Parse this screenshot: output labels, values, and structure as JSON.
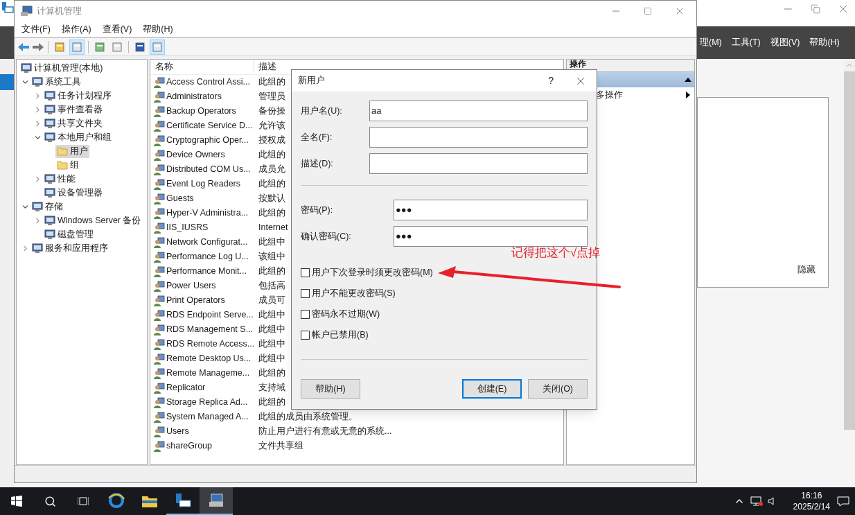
{
  "server_manager": {
    "menu": [
      "理(M)",
      "工具(T)",
      "视图(V)",
      "帮助(H)"
    ],
    "panel_text": "隐藏"
  },
  "window": {
    "title": "计算机管理",
    "menu": [
      "文件(F)",
      "操作(A)",
      "查看(V)",
      "帮助(H)"
    ],
    "toolbar": {
      "tree_toggle_pressed": true,
      "action_pane_toggle_pressed": true
    },
    "tree": [
      {
        "label": "计算机管理(本地)",
        "kind": "node",
        "selected": false,
        "children": [
          {
            "label": "系统工具",
            "kind": "node",
            "selected": false,
            "expanded": true,
            "children": [
              {
                "label": "任务计划程序",
                "kind": "node",
                "selected": false,
                "expanded": false
              },
              {
                "label": "事件查看器",
                "kind": "node",
                "selected": false,
                "expanded": false
              },
              {
                "label": "共享文件夹",
                "kind": "node",
                "selected": false,
                "expanded": false
              },
              {
                "label": "本地用户和组",
                "kind": "node",
                "selected": false,
                "expanded": true,
                "children": [
                  {
                    "label": "用户",
                    "kind": "folder",
                    "selected": true
                  },
                  {
                    "label": "组",
                    "kind": "folder",
                    "selected": false
                  }
                ]
              },
              {
                "label": "性能",
                "kind": "node",
                "selected": false,
                "expanded": false
              },
              {
                "label": "设备管理器",
                "kind": "node",
                "selected": false
              }
            ]
          },
          {
            "label": "存储",
            "kind": "node",
            "selected": false,
            "expanded": true,
            "children": [
              {
                "label": "Windows Server 备份",
                "kind": "node",
                "selected": false,
                "expanded": false
              },
              {
                "label": "磁盘管理",
                "kind": "node",
                "selected": false
              }
            ]
          },
          {
            "label": "服务和应用程序",
            "kind": "node",
            "selected": false,
            "expanded": false
          }
        ]
      }
    ],
    "list": {
      "columns": [
        "名称",
        "描述"
      ],
      "rows": [
        {
          "name": "Access Control Assi...",
          "description": "此组的"
        },
        {
          "name": "Administrators",
          "description": "管理员"
        },
        {
          "name": "Backup Operators",
          "description": "备份操"
        },
        {
          "name": "Certificate Service D...",
          "description": "允许该"
        },
        {
          "name": "Cryptographic Oper...",
          "description": "授权成"
        },
        {
          "name": "Device Owners",
          "description": "此组的"
        },
        {
          "name": "Distributed COM Us...",
          "description": "成员允"
        },
        {
          "name": "Event Log Readers",
          "description": "此组的"
        },
        {
          "name": "Guests",
          "description": "按默认"
        },
        {
          "name": "Hyper-V Administra...",
          "description": "此组的"
        },
        {
          "name": "IIS_IUSRS",
          "description": "Internet"
        },
        {
          "name": "Network Configurat...",
          "description": "此组中"
        },
        {
          "name": "Performance Log U...",
          "description": "该组中"
        },
        {
          "name": "Performance Monit...",
          "description": "此组的"
        },
        {
          "name": "Power Users",
          "description": "包括高"
        },
        {
          "name": "Print Operators",
          "description": "成员可"
        },
        {
          "name": "RDS Endpoint Serve...",
          "description": "此组中"
        },
        {
          "name": "RDS Management S...",
          "description": "此组中"
        },
        {
          "name": "RDS Remote Access...",
          "description": "此组中"
        },
        {
          "name": "Remote Desktop Us...",
          "description": "此组中"
        },
        {
          "name": "Remote Manageme...",
          "description": "此组的"
        },
        {
          "name": "Replicator",
          "description": "支持域"
        },
        {
          "name": "Storage Replica Ad...",
          "description": "此组的"
        },
        {
          "name": "System Managed A...",
          "description": "此组的成员由系统管理。"
        },
        {
          "name": "Users",
          "description": "防止用户进行有意或无意的系统..."
        },
        {
          "name": "shareGroup",
          "description": "文件共享组"
        }
      ]
    },
    "actions": {
      "header": "操作",
      "section_expanded": true,
      "items": [
        "多操作"
      ]
    }
  },
  "dialog": {
    "title": "新用户",
    "help": "?",
    "fields": [
      {
        "label": "用户名(U):",
        "value": "aa",
        "kind": "wide"
      },
      {
        "label": "全名(F):",
        "kind": "wide"
      },
      {
        "label": "描述(D):",
        "kind": "wide"
      },
      {
        "label": "密码(P):",
        "value": "●●●",
        "kind": "narrow"
      },
      {
        "label": "确认密码(C):",
        "value": "●●●",
        "kind": "narrow"
      }
    ],
    "checkboxes": [
      {
        "label": "用户下次登录时须更改密码(M)",
        "checked": false
      },
      {
        "label": "用户不能更改密码(S)",
        "checked": false
      },
      {
        "label": "密码永不过期(W)",
        "checked": false
      },
      {
        "label": "帐户已禁用(B)",
        "checked": false
      }
    ],
    "buttons": [
      {
        "label": "帮助(H)",
        "default": false
      },
      {
        "label": "创建(E)",
        "default": true
      },
      {
        "label": "关闭(O)",
        "default": false
      }
    ]
  },
  "annotation": {
    "text": "记得把这个√点掉"
  },
  "taskbar": {
    "apps": [
      {
        "running": false,
        "active": false
      },
      {
        "running": false,
        "active": false
      },
      {
        "running": true,
        "active": false
      },
      {
        "running": true,
        "active": true
      }
    ],
    "time": "16:16",
    "date": "2025/2/14"
  }
}
